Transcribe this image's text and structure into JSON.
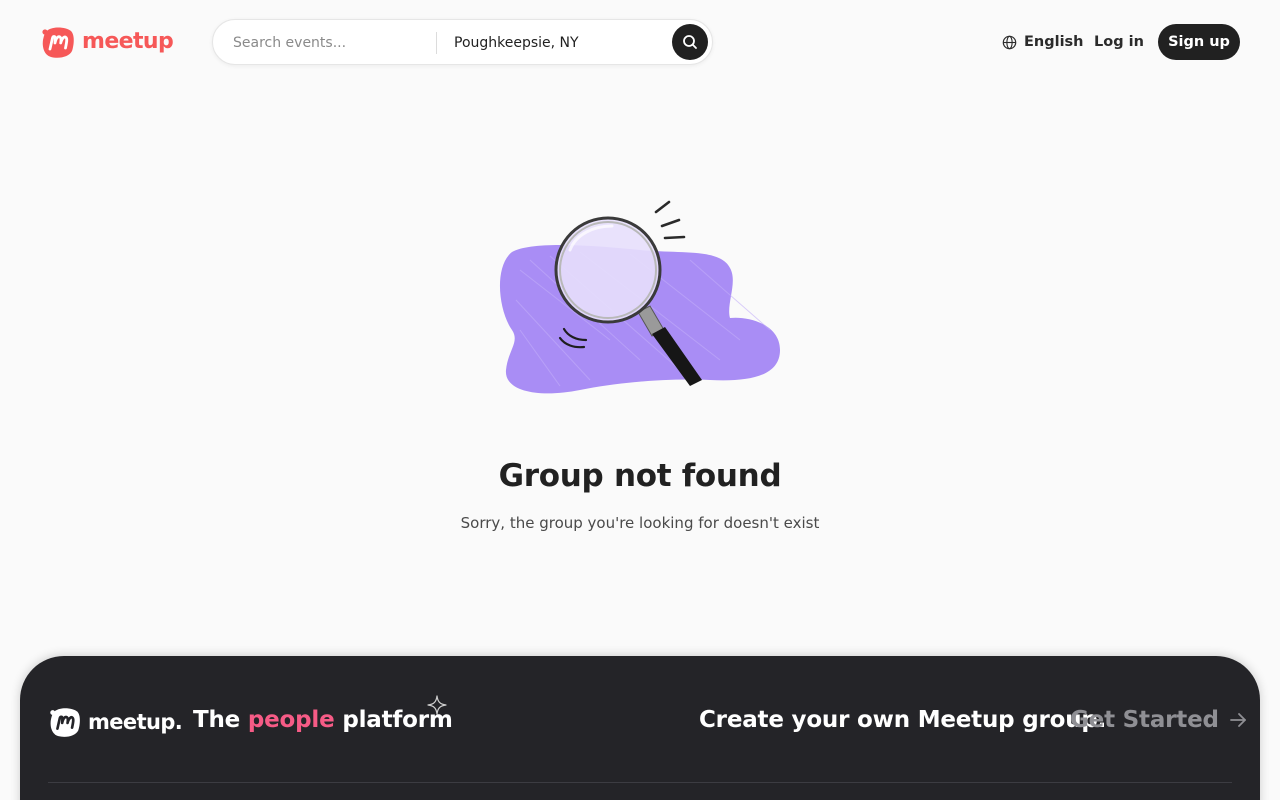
{
  "header": {
    "logo_text": "meetup",
    "search": {
      "placeholder": "Search events...",
      "location": "Poughkeepsie, NY",
      "button_icon": "search-icon"
    },
    "language": {
      "icon": "globe-icon",
      "label": "English"
    },
    "login_label": "Log in",
    "signup_label": "Sign up"
  },
  "main": {
    "illustration": "magnifying-glass-illustration",
    "title": "Group not found",
    "subtitle": "Sorry, the group you're looking for doesn't exist"
  },
  "footer": {
    "logo_text": "meetup",
    "logo_dot": ".",
    "tagline_before": "The",
    "tagline_highlight": "people",
    "tagline_after": "platform",
    "cta_text": "Create your own Meetup group.",
    "cta_link": "Get Started",
    "cta_icon": "arrow-right-icon"
  },
  "colors": {
    "brand": "#f65858",
    "highlight": "#f65b86",
    "dark": "#212121",
    "footer_bg": "#242428",
    "blob": "#a98df5"
  }
}
